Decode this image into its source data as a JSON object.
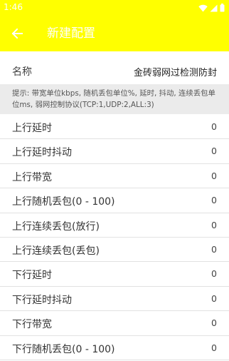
{
  "status_bar": {
    "time": "1:46"
  },
  "app_bar": {
    "title": "新建配置"
  },
  "name_field": {
    "label": "名称",
    "value": "金砖弱网过检测防封"
  },
  "hint": "提示: 带宽单位kbps, 随机丢包单位%, 延时, 抖动, 连续丢包单位ms, 弱网控制协议(TCP:1,UDP:2,ALL:3)",
  "params": [
    {
      "label": "上行延时",
      "value": "0"
    },
    {
      "label": "上行延时抖动",
      "value": "0"
    },
    {
      "label": "上行带宽",
      "value": "0"
    },
    {
      "label": "上行随机丢包(0 - 100)",
      "value": "0"
    },
    {
      "label": "上行连续丢包(放行)",
      "value": "0"
    },
    {
      "label": "上行连续丢包(丢包)",
      "value": "0"
    },
    {
      "label": "下行延时",
      "value": "0"
    },
    {
      "label": "下行延时抖动",
      "value": "0"
    },
    {
      "label": "下行带宽",
      "value": "0"
    },
    {
      "label": "下行随机丢包(0 - 100)",
      "value": "0"
    }
  ],
  "colors": {
    "accent": "#ffff00"
  }
}
